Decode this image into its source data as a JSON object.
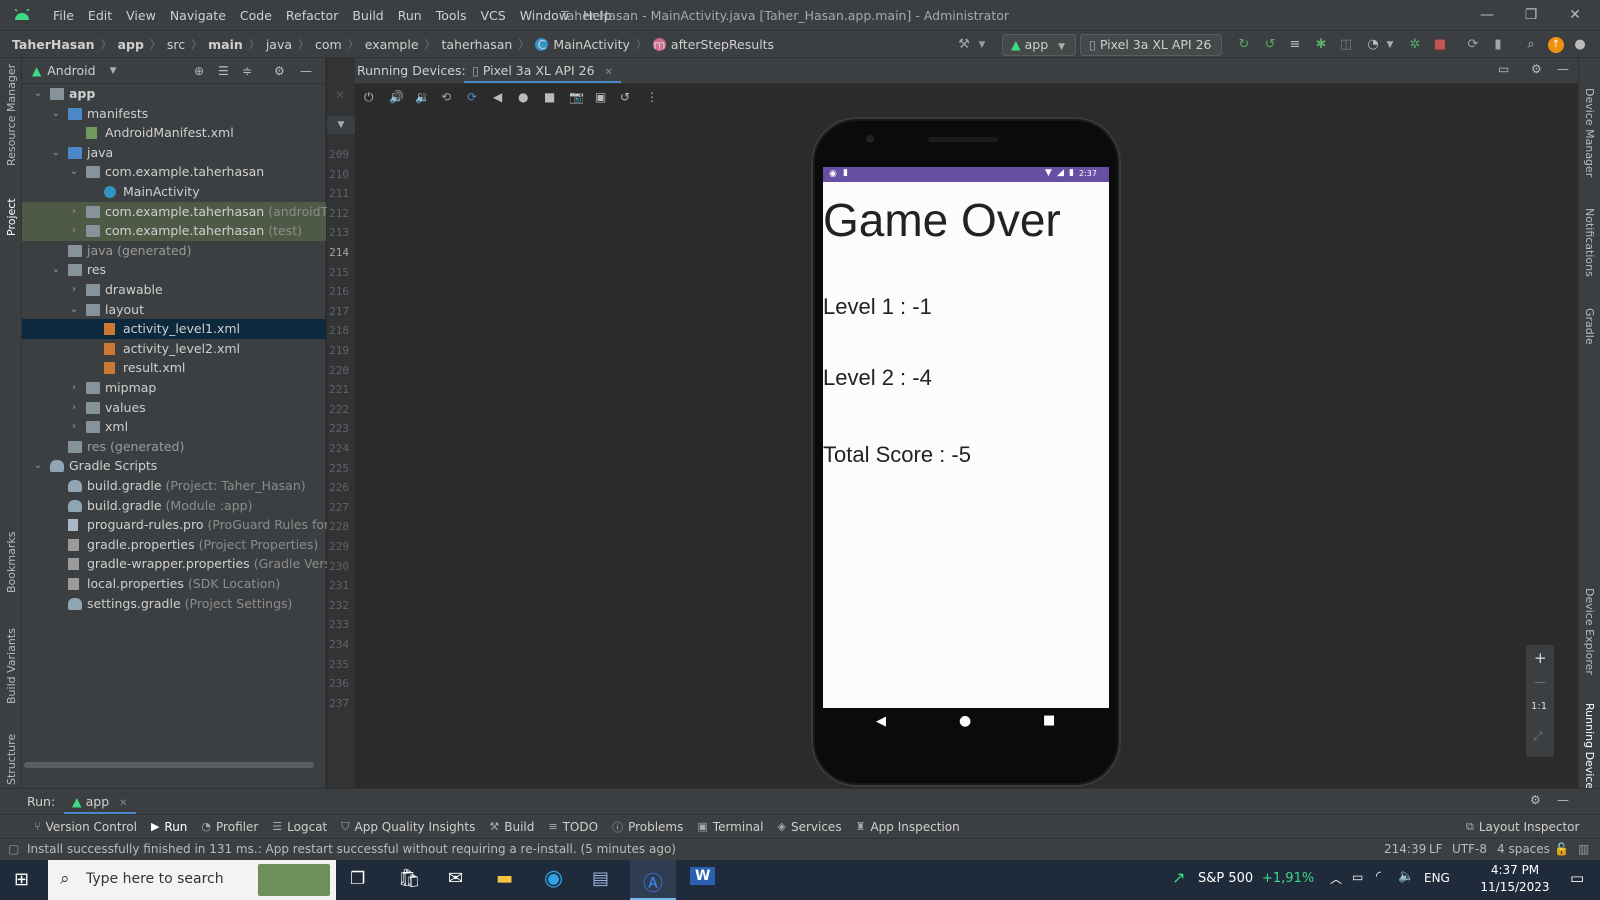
{
  "window": {
    "title": "Taher Hasan - MainActivity.java [Taher_Hasan.app.main] - Administrator",
    "controls": [
      "—",
      "❐",
      "✕"
    ]
  },
  "menu": [
    "File",
    "Edit",
    "View",
    "Navigate",
    "Code",
    "Refactor",
    "Build",
    "Run",
    "Tools",
    "VCS",
    "Window",
    "Help"
  ],
  "breadcrumb": [
    "TaherHasan",
    "app",
    "src",
    "main",
    "java",
    "com",
    "example",
    "taherhasan",
    "MainActivity",
    "afterStepResults"
  ],
  "toolbar": {
    "run_config": "app",
    "device": "Pixel 3a XL API 26"
  },
  "left_stripe": [
    "Resource Manager",
    "Project",
    "Bookmarks",
    "Build Variants",
    "Structure"
  ],
  "right_stripe": [
    "Device Manager",
    "Notifications",
    "Gradle",
    "Device Explorer",
    "Running Devices"
  ],
  "project": {
    "view": "Android",
    "tree": [
      {
        "label": "app",
        "sub": "",
        "depth": 0,
        "expanded": true,
        "icon": "module-folder",
        "bold": true
      },
      {
        "label": "manifests",
        "sub": "",
        "depth": 1,
        "expanded": true,
        "icon": "folder-blue"
      },
      {
        "label": "AndroidManifest.xml",
        "sub": "",
        "depth": 2,
        "expanded": null,
        "icon": "manifest-file"
      },
      {
        "label": "java",
        "sub": "",
        "depth": 1,
        "expanded": true,
        "icon": "folder-blue"
      },
      {
        "label": "com.example.taherhasan",
        "sub": "",
        "depth": 2,
        "expanded": true,
        "icon": "package"
      },
      {
        "label": "MainActivity",
        "sub": "",
        "depth": 3,
        "expanded": null,
        "icon": "class"
      },
      {
        "label": "com.example.taherhasan",
        "sub": "(androidTest)",
        "depth": 2,
        "expanded": false,
        "icon": "package",
        "highlight": "green"
      },
      {
        "label": "com.example.taherhasan",
        "sub": "(test)",
        "depth": 2,
        "expanded": false,
        "icon": "package",
        "highlight": "green"
      },
      {
        "label": "java (generated)",
        "sub": "",
        "depth": 1,
        "expanded": null,
        "icon": "folder-gen",
        "dim": true
      },
      {
        "label": "res",
        "sub": "",
        "depth": 1,
        "expanded": true,
        "icon": "folder-res"
      },
      {
        "label": "drawable",
        "sub": "",
        "depth": 2,
        "expanded": false,
        "icon": "folder"
      },
      {
        "label": "layout",
        "sub": "",
        "depth": 2,
        "expanded": true,
        "icon": "folder"
      },
      {
        "label": "activity_level1.xml",
        "sub": "",
        "depth": 3,
        "expanded": null,
        "icon": "layout-file",
        "selected": true
      },
      {
        "label": "activity_level2.xml",
        "sub": "",
        "depth": 3,
        "expanded": null,
        "icon": "layout-file"
      },
      {
        "label": "result.xml",
        "sub": "",
        "depth": 3,
        "expanded": null,
        "icon": "layout-file"
      },
      {
        "label": "mipmap",
        "sub": "",
        "depth": 2,
        "expanded": false,
        "icon": "folder"
      },
      {
        "label": "values",
        "sub": "",
        "depth": 2,
        "expanded": false,
        "icon": "folder"
      },
      {
        "label": "xml",
        "sub": "",
        "depth": 2,
        "expanded": false,
        "icon": "folder"
      },
      {
        "label": "res (generated)",
        "sub": "",
        "depth": 1,
        "expanded": null,
        "icon": "folder-gen",
        "dim": true
      },
      {
        "label": "Gradle Scripts",
        "sub": "",
        "depth": 0,
        "expanded": true,
        "icon": "gradle"
      },
      {
        "label": "build.gradle",
        "sub": "(Project: Taher_Hasan)",
        "depth": 1,
        "expanded": null,
        "icon": "gradle"
      },
      {
        "label": "build.gradle",
        "sub": "(Module :app)",
        "depth": 1,
        "expanded": null,
        "icon": "gradle"
      },
      {
        "label": "proguard-rules.pro",
        "sub": "(ProGuard Rules for \":app\")",
        "depth": 1,
        "expanded": null,
        "icon": "file"
      },
      {
        "label": "gradle.properties",
        "sub": "(Project Properties)",
        "depth": 1,
        "expanded": null,
        "icon": "properties"
      },
      {
        "label": "gradle-wrapper.properties",
        "sub": "(Gradle Version)",
        "depth": 1,
        "expanded": null,
        "icon": "properties"
      },
      {
        "label": "local.properties",
        "sub": "(SDK Location)",
        "depth": 1,
        "expanded": null,
        "icon": "properties"
      },
      {
        "label": "settings.gradle",
        "sub": "(Project Settings)",
        "depth": 1,
        "expanded": null,
        "icon": "gradle"
      }
    ]
  },
  "gutter": {
    "lines": [
      "209",
      "210",
      "211",
      "212",
      "213",
      "214",
      "215",
      "216",
      "217",
      "218",
      "219",
      "220",
      "221",
      "222",
      "223",
      "224",
      "225",
      "226",
      "227",
      "228",
      "229",
      "230",
      "231",
      "232",
      "233",
      "234",
      "235",
      "236",
      "237"
    ],
    "current": "214"
  },
  "running_devices": {
    "label": "Running Devices:",
    "tab": "Pixel 3a XL API 26",
    "zoom_labels": [
      "+",
      "—",
      "1:1"
    ]
  },
  "phone": {
    "status_time": "2:37",
    "title": "Game Over",
    "level1": "Level 1 : -1",
    "level2": "Level 2 : -4",
    "total": "Total Score : -5"
  },
  "run": {
    "label": "Run:",
    "tab": "app"
  },
  "tool_windows": [
    "Version Control",
    "Run",
    "Profiler",
    "Logcat",
    "App Quality Insights",
    "Build",
    "TODO",
    "Problems",
    "Terminal",
    "Services",
    "App Inspection"
  ],
  "layout_inspector": "Layout Inspector",
  "status": {
    "message": "Install successfully finished in 131 ms.: App restart successful without requiring a re-install. (5 minutes ago)",
    "position": "214:39",
    "line_sep": "LF",
    "encoding": "UTF-8",
    "indent": "4 spaces"
  },
  "taskbar": {
    "search_placeholder": "Type here to search",
    "stock_name": "S&P 500",
    "stock_change": "+1,91%",
    "lang": "ENG",
    "time": "4:37 PM",
    "date": "11/15/2023"
  },
  "colors": {
    "accent_purple": "#6750a4",
    "selection": "#0d293e",
    "test_highlight": "#4e5a46",
    "run_green": "#59a869",
    "stop_red": "#c75450"
  }
}
